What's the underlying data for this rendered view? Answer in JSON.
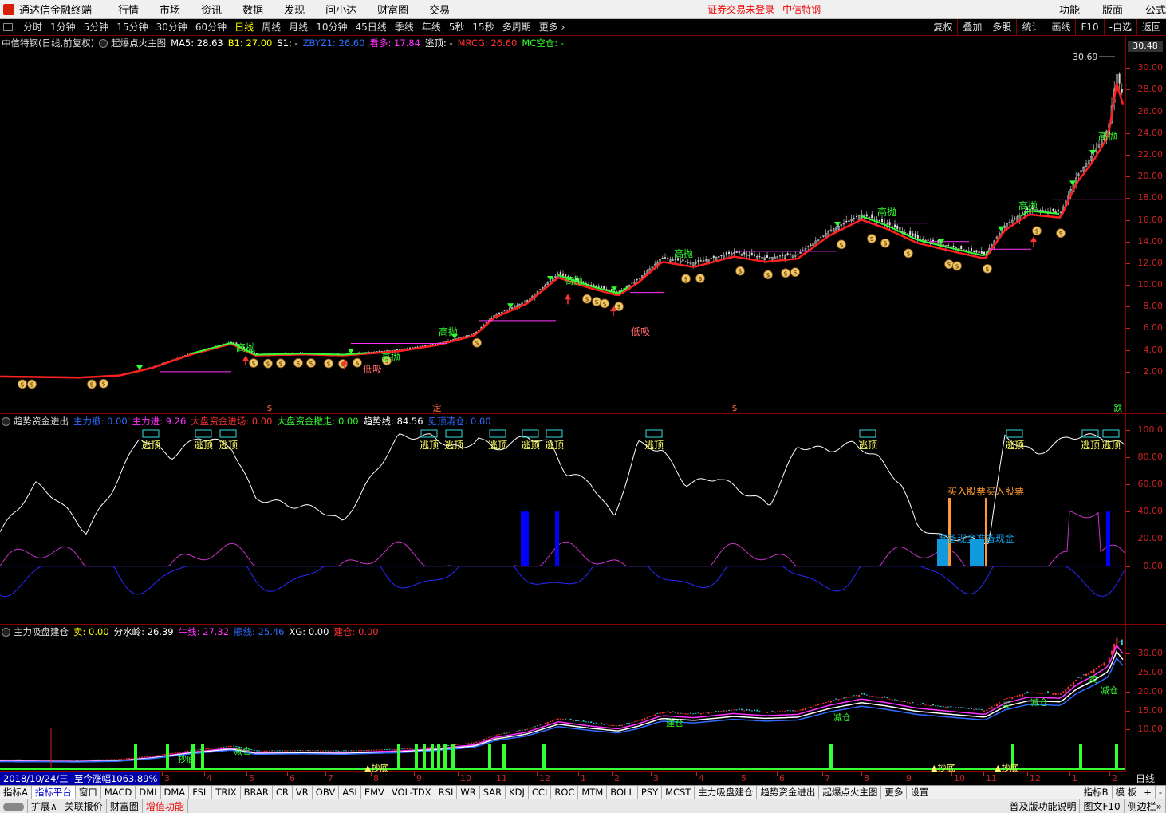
{
  "menubar": {
    "app_name": "通达信金融终端",
    "items": [
      "行情",
      "市场",
      "资讯",
      "数据",
      "发现",
      "问小达",
      "财富圈",
      "交易"
    ],
    "notice": "证券交易未登录",
    "stock_notice": "中信特钢",
    "right_items": [
      "功能",
      "版面",
      "公式"
    ]
  },
  "periods": {
    "items": [
      "分时",
      "1分钟",
      "5分钟",
      "15分钟",
      "30分钟",
      "60分钟",
      "日线",
      "周线",
      "月线",
      "10分钟",
      "45日线",
      "季线",
      "年线",
      "5秒",
      "15秒",
      "多周期",
      "更多 ›"
    ],
    "active": "日线",
    "right_buttons": [
      "复权",
      "叠加",
      "多股",
      "统计",
      "画线",
      "F10",
      "-自选",
      "返回"
    ]
  },
  "pane1": {
    "title": "中信特钢(日线,前复权)",
    "indicator": "起爆点火主图",
    "fields": [
      {
        "label": "MA5: 28.63",
        "color": "#ffffff"
      },
      {
        "label": "B1: 27.00",
        "color": "#ffff00"
      },
      {
        "label": "S1: -",
        "color": "#ffffff"
      },
      {
        "label": "ZBYZ1: 26.60",
        "color": "#2f6bff"
      },
      {
        "label": "看多: 17.84",
        "color": "#ff33ff"
      },
      {
        "label": "逃顶: -",
        "color": "#ffffff"
      },
      {
        "label": "MRCG: 26.60",
        "color": "#ff3333"
      },
      {
        "label": "MC空仓: -",
        "color": "#33ff33"
      }
    ],
    "price_box": "30.48",
    "high_label": "30.69",
    "yticks": [
      "30.00",
      "28.00",
      "26.00",
      "24.00",
      "22.00",
      "20.00",
      "18.00",
      "16.00",
      "14.00",
      "12.00",
      "10.00",
      "8.00",
      "6.00",
      "4.00",
      "2.00"
    ],
    "ylim": [
      0,
      32
    ],
    "annotations": [
      {
        "text": "高抛",
        "x": 296,
        "y": 440
      },
      {
        "text": "高抛",
        "x": 478,
        "y": 452
      },
      {
        "text": "高抛",
        "x": 550,
        "y": 420
      },
      {
        "text": "高抛",
        "x": 707,
        "y": 356
      },
      {
        "text": "高抛",
        "x": 845,
        "y": 322
      },
      {
        "text": "高抛",
        "x": 1100,
        "y": 270
      },
      {
        "text": "高抛",
        "x": 1277,
        "y": 262
      },
      {
        "text": "高抛",
        "x": 1377,
        "y": 175
      },
      {
        "text": "低吸",
        "x": 791,
        "y": 420
      },
      {
        "text": "低吸",
        "x": 455,
        "y": 467
      }
    ],
    "bottom_markers": [
      {
        "text": "$",
        "x": 338
      },
      {
        "text": "定",
        "x": 548
      },
      {
        "text": "$",
        "x": 921
      },
      {
        "text": "跌",
        "x": 1402
      }
    ]
  },
  "pane2": {
    "title": "趋势资金进出",
    "fields": [
      {
        "label": "主力撤: 0.00",
        "color": "#2f6bff"
      },
      {
        "label": "主力进: 9.26",
        "color": "#ff33ff"
      },
      {
        "label": "大盘资金进场: 0.00",
        "color": "#ff3333"
      },
      {
        "label": "大盘资金撤走: 0.00",
        "color": "#33ff33"
      },
      {
        "label": "趋势线: 84.56",
        "color": "#ffffff"
      },
      {
        "label": "见顶清仓: 0.00",
        "color": "#2f6bff"
      }
    ],
    "yticks": [
      "100.0",
      "80.00",
      "60.00",
      "40.00",
      "20.00",
      "0.00"
    ],
    "ylim": [
      -40,
      105
    ],
    "labels": [
      {
        "text": "逃顶",
        "x": 189
      },
      {
        "text": "逃顶",
        "x": 255
      },
      {
        "text": "逃顶",
        "x": 286
      },
      {
        "text": "逃顶",
        "x": 538
      },
      {
        "text": "逃顶",
        "x": 569
      },
      {
        "text": "逃顶",
        "x": 624
      },
      {
        "text": "逃顶",
        "x": 665
      },
      {
        "text": "逃顶",
        "x": 695
      },
      {
        "text": "逃顶",
        "x": 820
      },
      {
        "text": "逃顶",
        "x": 1088
      },
      {
        "text": "逃顶",
        "x": 1272
      },
      {
        "text": "逃顶",
        "x": 1367
      },
      {
        "text": "逃顶",
        "x": 1393
      }
    ],
    "buy_label": "买入股票买入股票",
    "prepare_label": "准备现金准备现金"
  },
  "pane3": {
    "title": "主力吸盘建仓",
    "fields": [
      {
        "label": "卖: 0.00",
        "color": "#ffff00"
      },
      {
        "label": "分水岭: 26.39",
        "color": "#ffffff"
      },
      {
        "label": "牛线: 27.32",
        "color": "#ff33ff"
      },
      {
        "label": "熊线: 25.46",
        "color": "#2f6bff"
      },
      {
        "label": "XG: 0.00",
        "color": "#ffffff"
      },
      {
        "label": "建仓: 0.00",
        "color": "#ff3333"
      }
    ],
    "yticks": [
      "30.00",
      "25.00",
      "20.00",
      "15.00",
      "10.00"
    ],
    "ylim": [
      0,
      33
    ],
    "annotations": [
      {
        "text": "减仓",
        "x": 293,
        "y": 945
      },
      {
        "text": "建仓",
        "x": 835,
        "y": 910
      },
      {
        "text": "减仓",
        "x": 1045,
        "y": 903
      },
      {
        "text": "减仓",
        "x": 1292,
        "y": 884
      },
      {
        "text": "减仓",
        "x": 1380,
        "y": 869
      },
      {
        "text": "卖",
        "x": 1365,
        "y": 855
      },
      {
        "text": "抄底",
        "x": 223,
        "y": 955
      },
      {
        "text": "买",
        "x": 1256,
        "y": 887
      }
    ],
    "bottom_labels": [
      {
        "text": "▲抄底",
        "x": 465
      },
      {
        "text": "▲抄底",
        "x": 1175
      },
      {
        "text": "▲抄底",
        "x": 1255
      }
    ]
  },
  "timebar": {
    "date": "2018/10/24/三",
    "change": "至今涨幅1063.89%",
    "months": [
      {
        "text": "3",
        "x": 206
      },
      {
        "text": "4",
        "x": 259
      },
      {
        "text": "5",
        "x": 312
      },
      {
        "text": "6",
        "x": 363
      },
      {
        "text": "7",
        "x": 411
      },
      {
        "text": "8",
        "x": 468
      },
      {
        "text": "9",
        "x": 522
      },
      {
        "text": "10",
        "x": 577
      },
      {
        "text": "11",
        "x": 622
      },
      {
        "text": "12",
        "x": 676
      },
      {
        "text": "1",
        "x": 728
      },
      {
        "text": "2",
        "x": 770
      },
      {
        "text": "3",
        "x": 819
      },
      {
        "text": "4",
        "x": 876
      },
      {
        "text": "5",
        "x": 929
      },
      {
        "text": "6",
        "x": 977
      },
      {
        "text": "7",
        "x": 1034
      },
      {
        "text": "8",
        "x": 1083
      },
      {
        "text": "9",
        "x": 1136
      },
      {
        "text": "10",
        "x": 1196
      },
      {
        "text": "11",
        "x": 1236
      },
      {
        "text": "12",
        "x": 1291
      },
      {
        "text": "1",
        "x": 1344
      },
      {
        "text": "2",
        "x": 1394
      }
    ],
    "period": "日线"
  },
  "tabbar": {
    "items": [
      "指标A",
      "指标平台",
      "窗口",
      "MACD",
      "DMI",
      "DMA",
      "FSL",
      "TRIX",
      "BRAR",
      "CR",
      "VR",
      "OBV",
      "ASI",
      "EMV",
      "VOL-TDX",
      "RSI",
      "WR",
      "SAR",
      "KDJ",
      "CCI",
      "ROC",
      "MTM",
      "BOLL",
      "PSY",
      "MCST",
      "主力吸盘建仓",
      "趋势资金进出",
      "起爆点火主图",
      "更多",
      "设置"
    ],
    "highlighted": [
      "指标平台"
    ],
    "right_items": [
      "指标B",
      "模 板",
      "+",
      "-"
    ]
  },
  "statusbar": {
    "toggle": "",
    "items": [
      "扩展∧",
      "关联报价",
      "财富圈",
      "增值功能"
    ],
    "red_items": [
      "增值功能"
    ],
    "right_items": [
      "普及版功能说明",
      "图文F10",
      "侧边栏»"
    ]
  },
  "colors": {
    "up": "#ff3333",
    "down": "#33dddd",
    "ma_line": "#ff2020",
    "green_line": "#33ff33",
    "grid": "#800000"
  }
}
